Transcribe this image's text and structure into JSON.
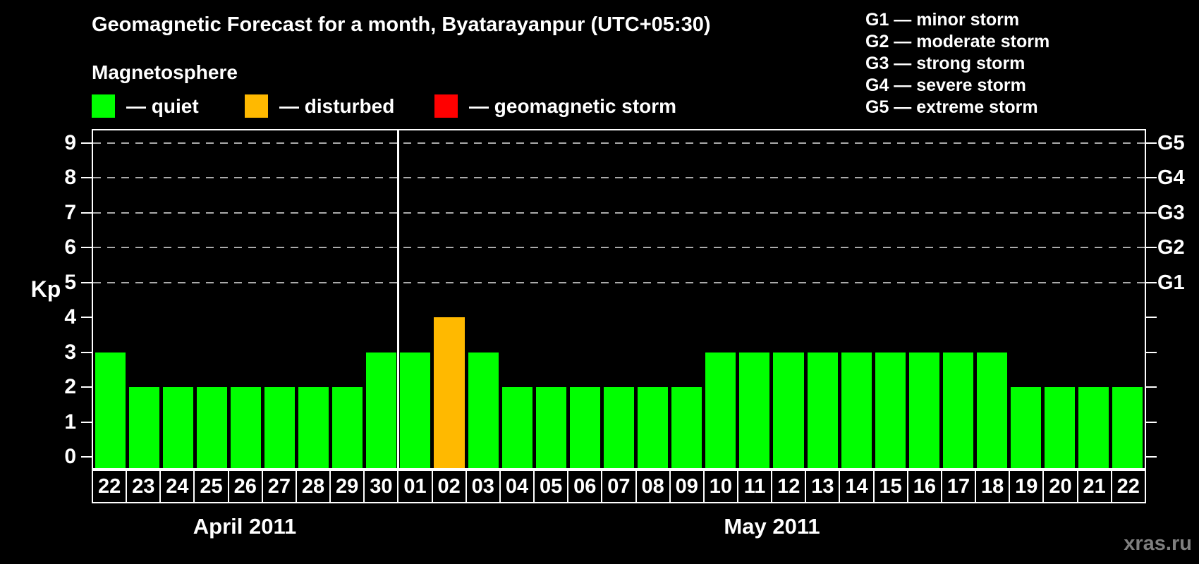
{
  "title": "Geomagnetic Forecast for a month, Byatarayanpur (UTC+05:30)",
  "subtitle": "Magnetosphere",
  "legend": {
    "items": [
      {
        "label": "— quiet",
        "color": "#00ff00",
        "key": "quiet"
      },
      {
        "label": "— disturbed",
        "color": "#ffb900",
        "key": "disturbed"
      },
      {
        "label": "— geomagnetic storm",
        "color": "#ff0000",
        "key": "storm"
      }
    ]
  },
  "g_legend": {
    "items": [
      "G1 — minor storm",
      "G2 — moderate storm",
      "G3 — strong storm",
      "G4 — severe storm",
      "G5 — extreme storm"
    ]
  },
  "watermark": "xras.ru",
  "chart_data": {
    "type": "bar",
    "ylabel": "Kp",
    "ylim": [
      0,
      9
    ],
    "y_ticks": [
      0,
      1,
      2,
      3,
      4,
      5,
      6,
      7,
      8,
      9
    ],
    "gridlines_at": [
      5,
      6,
      7,
      8,
      9
    ],
    "grid": "dashed",
    "legend_position": "top",
    "right_axis_labels": [
      {
        "label": "G1",
        "kp": 5
      },
      {
        "label": "G2",
        "kp": 6
      },
      {
        "label": "G3",
        "kp": 7
      },
      {
        "label": "G4",
        "kp": 8
      },
      {
        "label": "G5",
        "kp": 9
      }
    ],
    "colors": {
      "quiet": "#00ff00",
      "disturbed": "#ffb900",
      "storm": "#ff0000"
    },
    "months": [
      {
        "label": "April 2011",
        "days": [
          {
            "day": "22",
            "kp": 3,
            "status": "quiet"
          },
          {
            "day": "23",
            "kp": 2,
            "status": "quiet"
          },
          {
            "day": "24",
            "kp": 2,
            "status": "quiet"
          },
          {
            "day": "25",
            "kp": 2,
            "status": "quiet"
          },
          {
            "day": "26",
            "kp": 2,
            "status": "quiet"
          },
          {
            "day": "27",
            "kp": 2,
            "status": "quiet"
          },
          {
            "day": "28",
            "kp": 2,
            "status": "quiet"
          },
          {
            "day": "29",
            "kp": 2,
            "status": "quiet"
          },
          {
            "day": "30",
            "kp": 3,
            "status": "quiet"
          }
        ]
      },
      {
        "label": "May 2011",
        "days": [
          {
            "day": "01",
            "kp": 3,
            "status": "quiet"
          },
          {
            "day": "02",
            "kp": 4,
            "status": "disturbed"
          },
          {
            "day": "03",
            "kp": 3,
            "status": "quiet"
          },
          {
            "day": "04",
            "kp": 2,
            "status": "quiet"
          },
          {
            "day": "05",
            "kp": 2,
            "status": "quiet"
          },
          {
            "day": "06",
            "kp": 2,
            "status": "quiet"
          },
          {
            "day": "07",
            "kp": 2,
            "status": "quiet"
          },
          {
            "day": "08",
            "kp": 2,
            "status": "quiet"
          },
          {
            "day": "09",
            "kp": 2,
            "status": "quiet"
          },
          {
            "day": "10",
            "kp": 3,
            "status": "quiet"
          },
          {
            "day": "11",
            "kp": 3,
            "status": "quiet"
          },
          {
            "day": "12",
            "kp": 3,
            "status": "quiet"
          },
          {
            "day": "13",
            "kp": 3,
            "status": "quiet"
          },
          {
            "day": "14",
            "kp": 3,
            "status": "quiet"
          },
          {
            "day": "15",
            "kp": 3,
            "status": "quiet"
          },
          {
            "day": "16",
            "kp": 3,
            "status": "quiet"
          },
          {
            "day": "17",
            "kp": 3,
            "status": "quiet"
          },
          {
            "day": "18",
            "kp": 3,
            "status": "quiet"
          },
          {
            "day": "19",
            "kp": 2,
            "status": "quiet"
          },
          {
            "day": "20",
            "kp": 2,
            "status": "quiet"
          },
          {
            "day": "21",
            "kp": 2,
            "status": "quiet"
          },
          {
            "day": "22",
            "kp": 2,
            "status": "quiet"
          }
        ]
      }
    ]
  }
}
